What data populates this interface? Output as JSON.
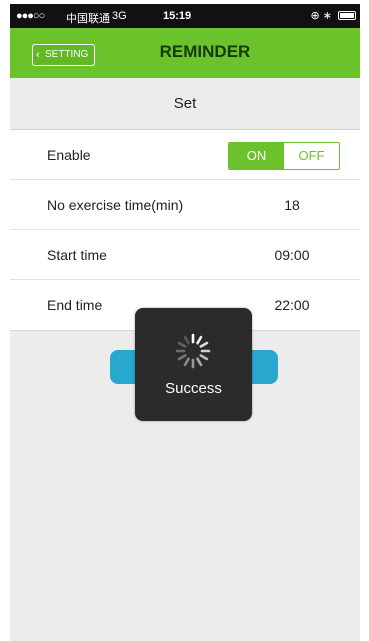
{
  "status_bar": {
    "signal": "●●●○○",
    "carrier": "中国联通",
    "network": "3G",
    "time": "15:19"
  },
  "nav": {
    "back_label": "SETTING",
    "title": "REMINDER"
  },
  "section": {
    "title": "Set"
  },
  "rows": {
    "enable": {
      "label": "Enable",
      "on_label": "ON",
      "off_label": "OFF",
      "selected": "ON"
    },
    "no_exercise": {
      "label": "No exercise time(min)",
      "value": "18"
    },
    "start_time": {
      "label": "Start time",
      "value": "09:00"
    },
    "end_time": {
      "label": "End time",
      "value": "22:00"
    }
  },
  "hud": {
    "message": "Success"
  },
  "colors": {
    "accent_green": "#6bc22a",
    "save_blue": "#29a8cf",
    "hud_background": "#2b2b2b"
  }
}
